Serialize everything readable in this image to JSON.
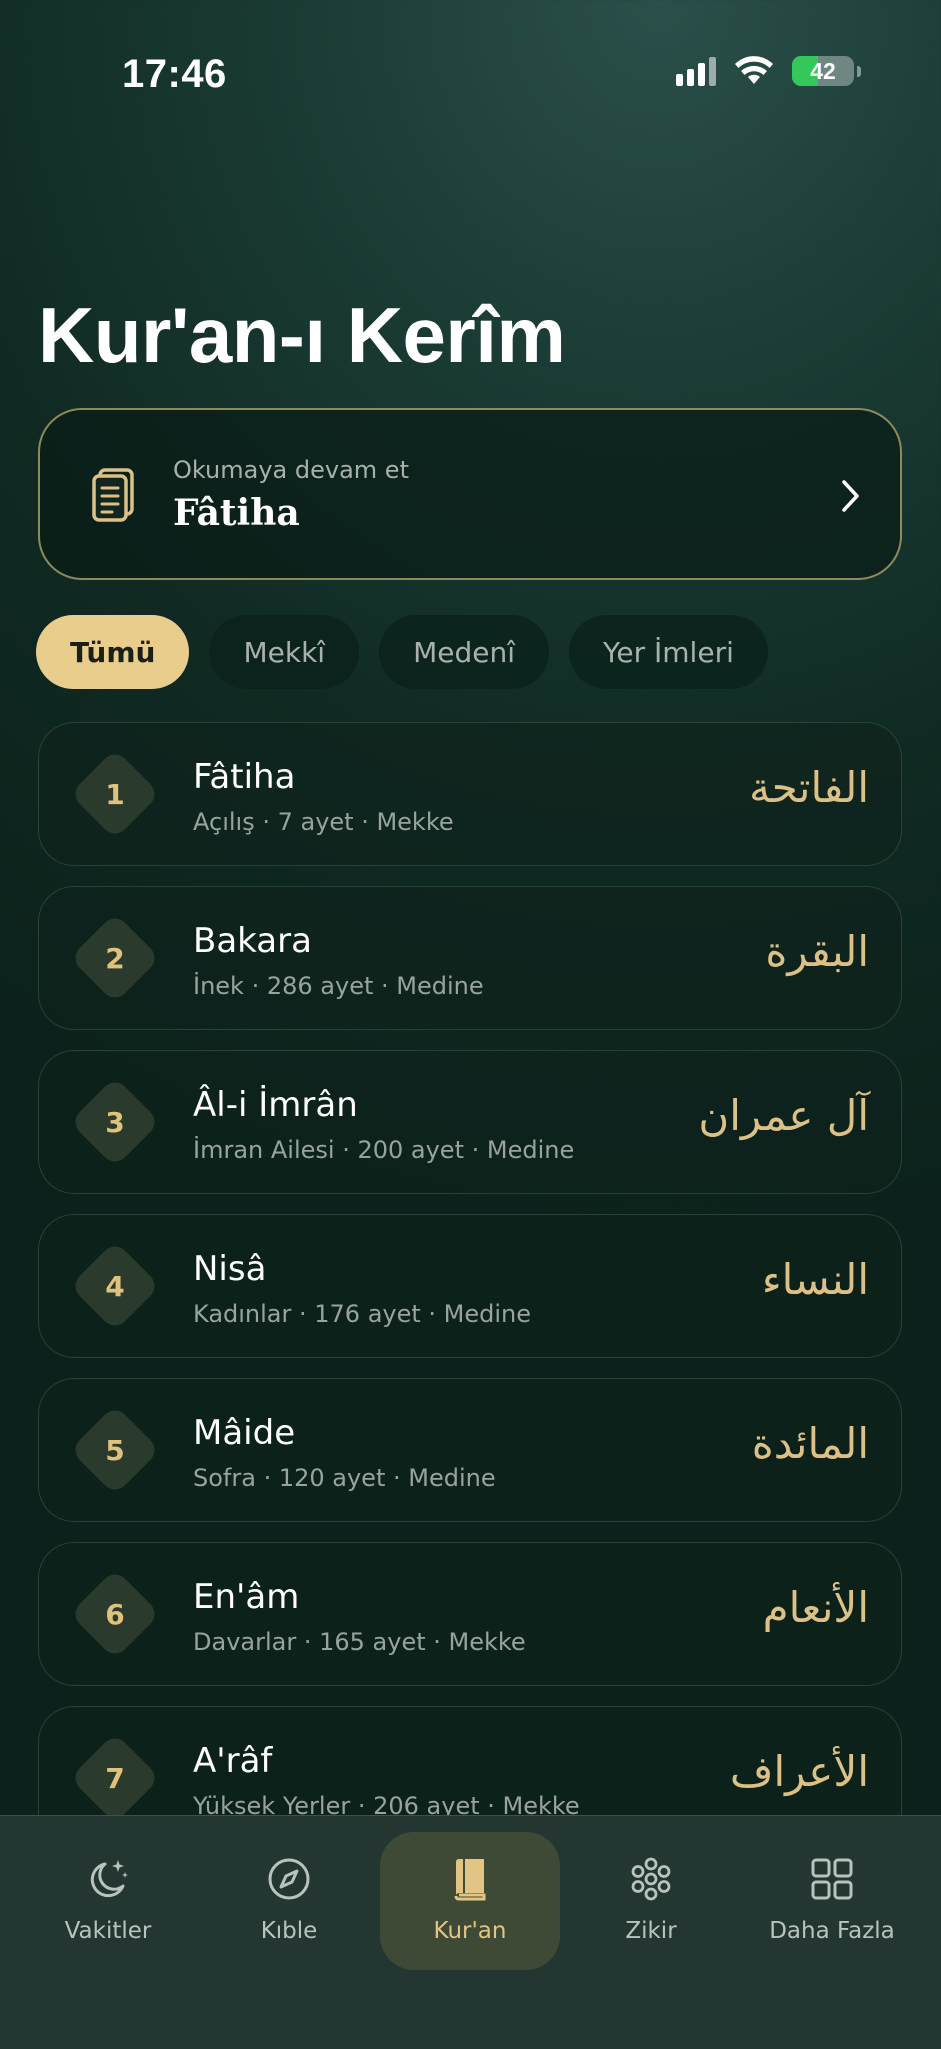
{
  "status_bar": {
    "time": "17:46",
    "battery": "42",
    "battery_level": 0.42
  },
  "page": {
    "title": "Kur'an-ı Kerîm"
  },
  "continue_reading": {
    "label": "Okumaya devam et",
    "surah": "Fâtiha"
  },
  "filters": [
    {
      "label": "Tümü",
      "active": true
    },
    {
      "label": "Mekkî",
      "active": false
    },
    {
      "label": "Medenî",
      "active": false
    },
    {
      "label": "Yer İmleri",
      "active": false
    }
  ],
  "surahs": [
    {
      "number": "1",
      "name": "Fâtiha",
      "meta": "Açılış · 7 ayet · Mekke",
      "arabic": "الفاتحة"
    },
    {
      "number": "2",
      "name": "Bakara",
      "meta": "İnek · 286 ayet · Medine",
      "arabic": "البقرة"
    },
    {
      "number": "3",
      "name": "Âl-i İmrân",
      "meta": "İmran Ailesi · 200 ayet · Medine",
      "arabic": "آل عمران"
    },
    {
      "number": "4",
      "name": "Nisâ",
      "meta": "Kadınlar · 176 ayet · Medine",
      "arabic": "النساء"
    },
    {
      "number": "5",
      "name": "Mâide",
      "meta": "Sofra · 120 ayet · Medine",
      "arabic": "المائدة"
    },
    {
      "number": "6",
      "name": "En'âm",
      "meta": "Davarlar · 165 ayet · Mekke",
      "arabic": "الأنعام"
    },
    {
      "number": "7",
      "name": "A'râf",
      "meta": "Yüksek Yerler · 206 ayet · Mekke",
      "arabic": "الأعراف"
    }
  ],
  "tabs": [
    {
      "label": "Vakitler",
      "icon": "moon-star-icon",
      "active": false
    },
    {
      "label": "Kıble",
      "icon": "compass-icon",
      "active": false
    },
    {
      "label": "Kur'an",
      "icon": "book-icon",
      "active": true
    },
    {
      "label": "Zikir",
      "icon": "prayer-beads-icon",
      "active": false
    },
    {
      "label": "Daha Fazla",
      "icon": "grid-icon",
      "active": false
    }
  ],
  "colors": {
    "accent_gold": "#e9cd8c",
    "arabic_gold": "#dcc085",
    "battery_green": "#34c759"
  }
}
